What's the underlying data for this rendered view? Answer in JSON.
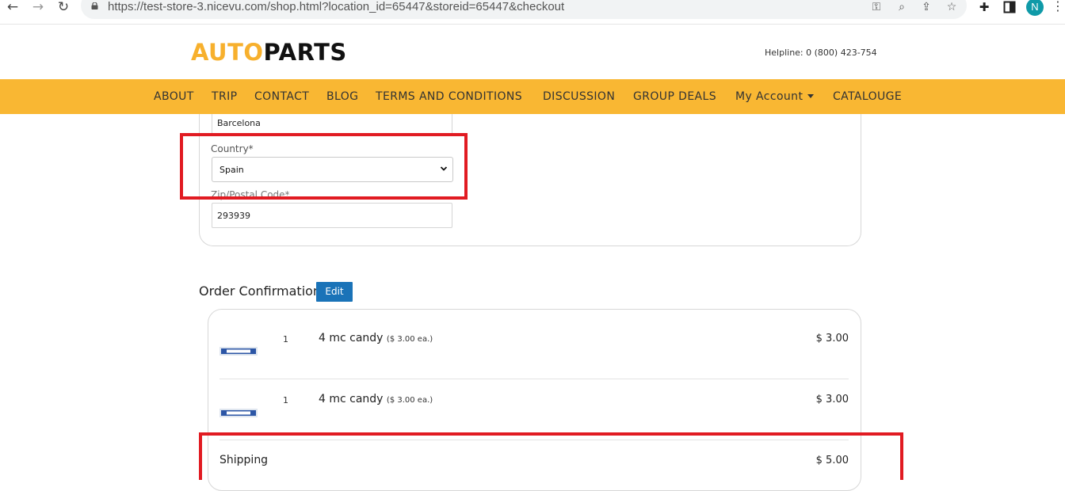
{
  "browser": {
    "url": "https://test-store-3.nicevu.com/shop.html?location_id=65447&storeid=65447&checkout",
    "profile_initial": "N",
    "icons": [
      "back-arrow",
      "forward-arrow",
      "reload",
      "lock",
      "key",
      "zoom",
      "share",
      "star",
      "puzzle",
      "side-panel",
      "profile",
      "menu"
    ]
  },
  "header": {
    "logo_auto": "AUTO",
    "logo_parts": "PARTS",
    "helpline": "Helpline: 0 (800) 423-754"
  },
  "nav": {
    "items": [
      "ABOUT",
      "TRIP",
      "CONTACT",
      "BLOG",
      "TERMS AND CONDITIONS",
      "DISCUSSION",
      "GROUP DEALS",
      "My Account",
      "CATALOUGE"
    ]
  },
  "address": {
    "city_value": "Barcelona",
    "country_label": "Country*",
    "country_value": "Spain",
    "zip_label": "Zip/Postal Code*",
    "zip_value": "293939"
  },
  "order": {
    "title": "Order Confirmation",
    "edit_label": "Edit",
    "items": [
      {
        "qty": "1",
        "name": "4 mc candy",
        "each": "($ 3.00 ea.)",
        "price": "$ 3.00"
      },
      {
        "qty": "1",
        "name": "4 mc candy",
        "each": "($ 3.00 ea.)",
        "price": "$ 3.00"
      }
    ],
    "shipping_label": "Shipping",
    "shipping_price": "$ 5.00"
  },
  "colors": {
    "brand_yellow": "#f9b733",
    "logo_yellow": "#f7b02d",
    "edit_blue": "#1a73b8",
    "annotation_red": "#e11b22"
  }
}
